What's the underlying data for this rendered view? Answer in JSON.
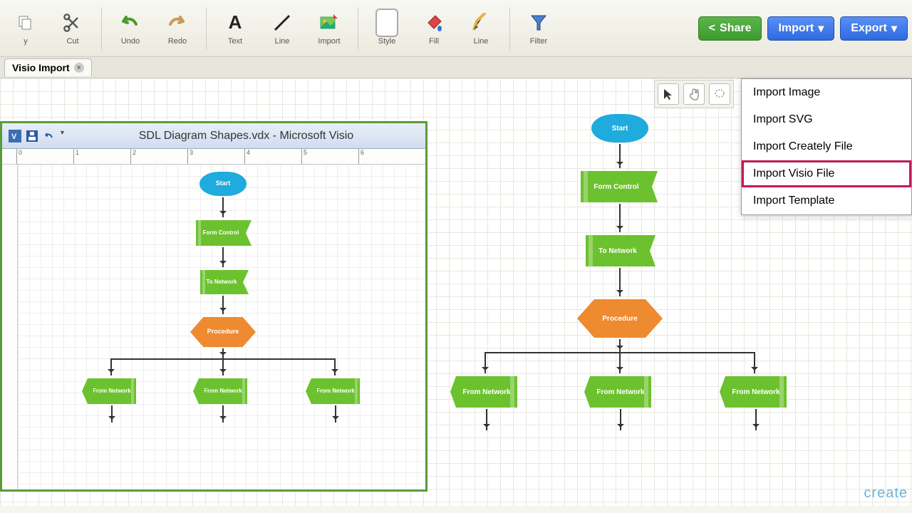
{
  "toolbar": {
    "copy": "y",
    "cut": "Cut",
    "undo": "Undo",
    "redo": "Redo",
    "text": "Text",
    "line": "Line",
    "import": "Import",
    "style": "Style",
    "fill": "Fill",
    "line2": "Line",
    "filter": "Filter"
  },
  "buttons": {
    "share": "Share",
    "import": "Import",
    "export": "Export"
  },
  "tab": {
    "title": "Visio Import"
  },
  "dropdown": {
    "items": [
      "Import Image",
      "Import SVG",
      "Import Creately File",
      "Import Visio File",
      "Import Template"
    ],
    "highlight_index": 3
  },
  "visio": {
    "title": "SDL Diagram Shapes.vdx  -  Microsoft Visio",
    "ruler_marks": [
      "0",
      "1",
      "2",
      "3",
      "4",
      "5",
      "6"
    ]
  },
  "flowchart": {
    "start": "Start",
    "form_control": "Form Control",
    "to_network": "To Network",
    "procedure": "Procedure",
    "from_network": "From Network"
  },
  "branding": "create"
}
